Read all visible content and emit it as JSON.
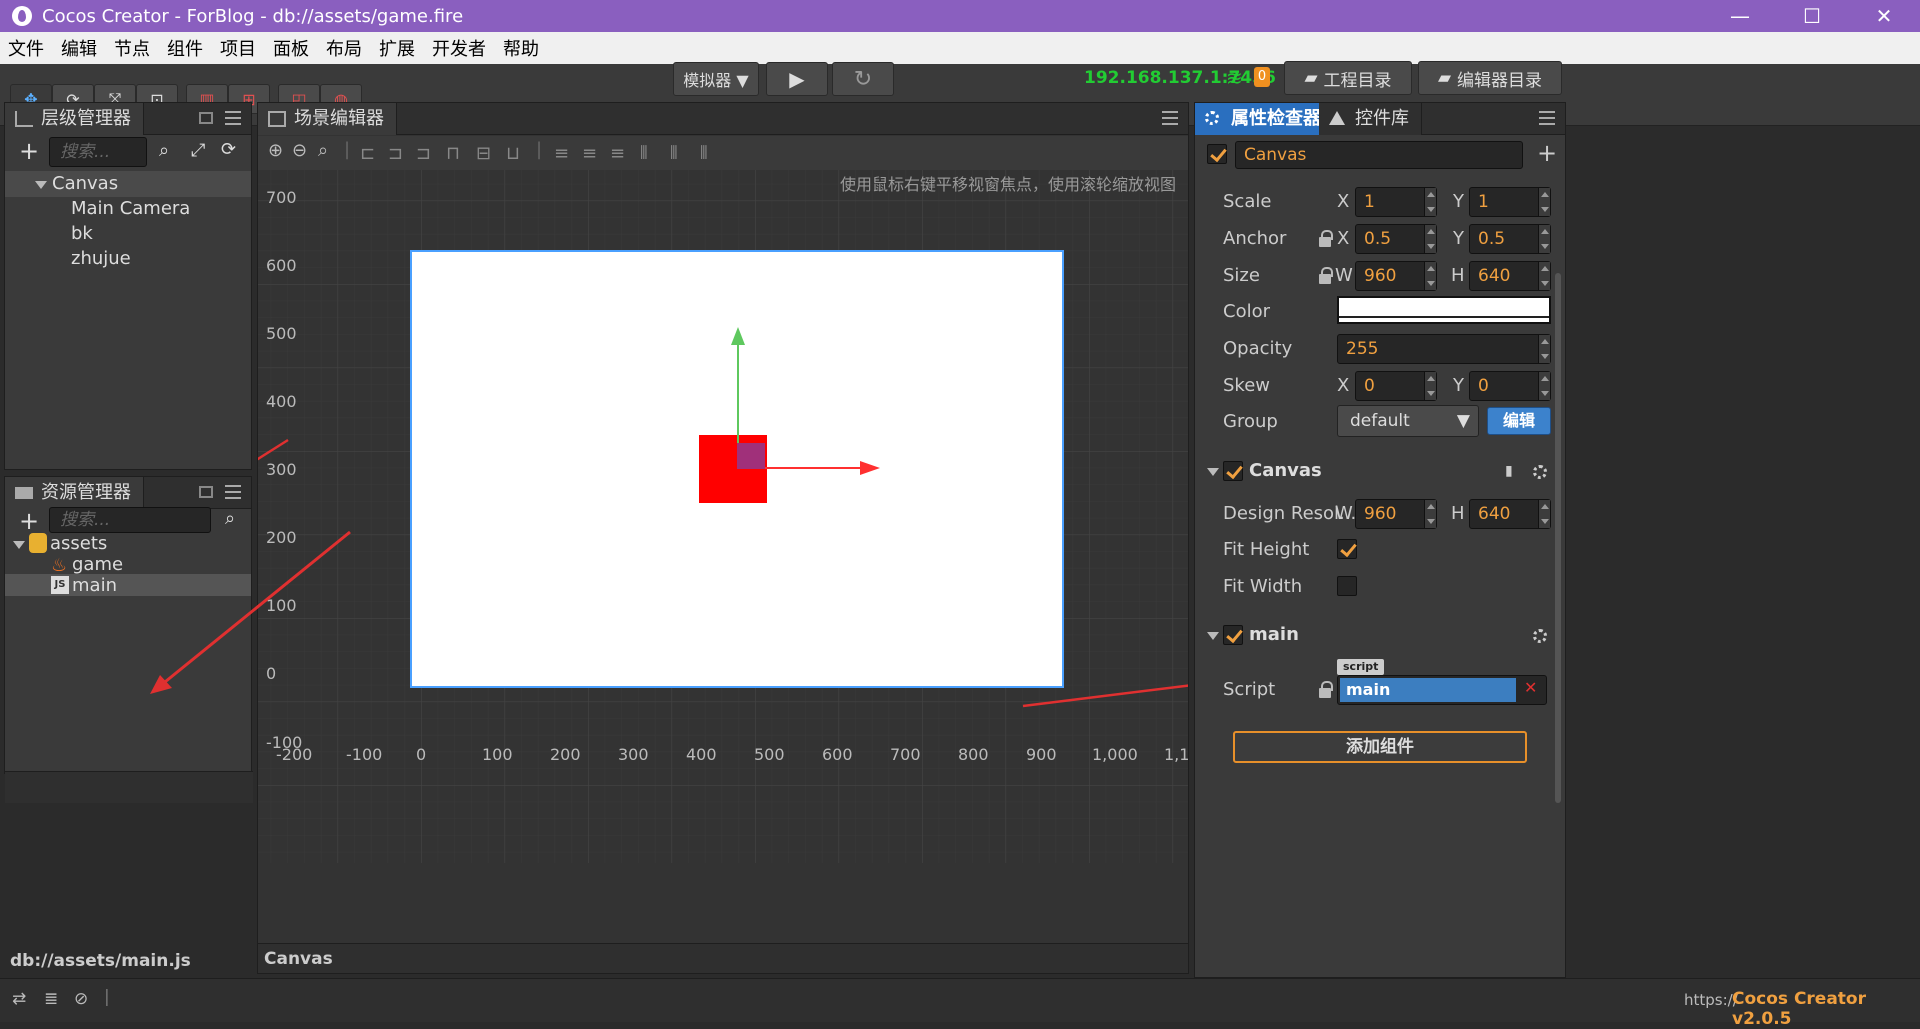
{
  "window": {
    "title": "Cocos Creator - ForBlog - db://assets/game.fire",
    "min": "—",
    "max": "☐",
    "close": "✕"
  },
  "menu": [
    "文件",
    "编辑",
    "节点",
    "组件",
    "项目",
    "面板",
    "布局",
    "扩展",
    "开发者",
    "帮助"
  ],
  "toolbar": {
    "simulator_label": "模拟器 ▼",
    "play_glyph": "▶",
    "refresh_glyph": "↻",
    "ip": "192.168.137.1:7456",
    "badge": "0",
    "project_dir": "工程目录",
    "editor_dir": "编辑器目录",
    "ip_color": "#22cc33"
  },
  "hierarchy": {
    "tab": "层级管理器",
    "search_placeholder": "搜索...",
    "root": "Canvas",
    "children": [
      "Main Camera",
      "bk",
      "zhujue"
    ]
  },
  "assets": {
    "tab": "资源管理器",
    "search_placeholder": "搜索...",
    "root": "assets",
    "items": [
      "game",
      "main"
    ],
    "js_badge": "JS",
    "footer": "db://assets/main.js"
  },
  "scene": {
    "tab": "场景编辑器",
    "hint": "使用鼠标右键平移视窗焦点，使用滚轮缩放视图",
    "y_ticks": [
      "700",
      "600",
      "500",
      "400",
      "300",
      "200",
      "100",
      "0",
      "-100"
    ],
    "x_ticks": [
      "-200",
      "-100",
      "0",
      "100",
      "200",
      "300",
      "400",
      "500",
      "600",
      "700",
      "800",
      "900",
      "1,000",
      "1,1"
    ],
    "footer": "Canvas",
    "canvas_border_color": "#4aa0ff",
    "node_color": "#ff0000"
  },
  "inspector": {
    "tab_active": "属性检查器",
    "tab_other": "控件库",
    "node_name": "Canvas",
    "scale": {
      "label": "Scale",
      "xl": "X",
      "x": "1",
      "yl": "Y",
      "y": "1"
    },
    "anchor": {
      "label": "Anchor",
      "xl": "X",
      "x": "0.5",
      "yl": "Y",
      "y": "0.5"
    },
    "size": {
      "label": "Size",
      "xl": "W",
      "x": "960",
      "yl": "H",
      "y": "640"
    },
    "color": {
      "label": "Color"
    },
    "opacity": {
      "label": "Opacity",
      "value": "255"
    },
    "skew": {
      "label": "Skew",
      "xl": "X",
      "x": "0",
      "yl": "Y",
      "y": "0"
    },
    "group": {
      "label": "Group",
      "value": "default",
      "edit": "编辑"
    },
    "canvas_comp": {
      "title": "Canvas",
      "design_label": "Design Resol...",
      "wl": "W",
      "w": "960",
      "hl": "H",
      "h": "640",
      "fit_height": "Fit Height",
      "fit_width": "Fit Width"
    },
    "main_comp": {
      "title": "main",
      "script_label": "Script",
      "script_tag": "script",
      "script_value": "main",
      "remove": "✕"
    },
    "add_component": "添加组件"
  },
  "status": {
    "url": "https://",
    "version": "Cocos Creator v2.0.5",
    "version_color": "#f0a040"
  }
}
